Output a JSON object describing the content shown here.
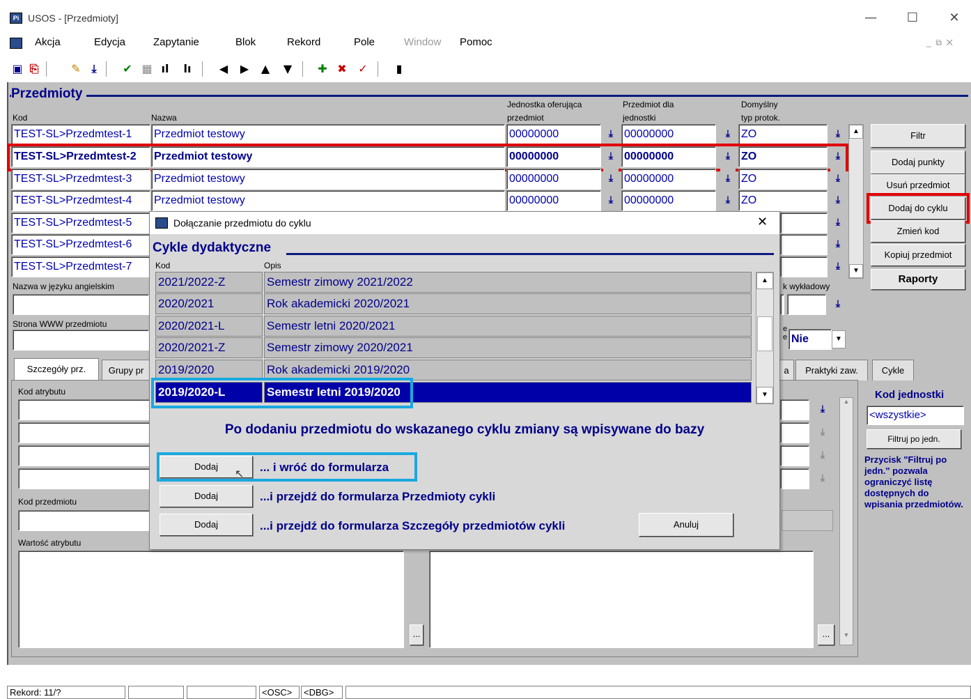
{
  "window": {
    "title": "USOS - [Przedmioty]",
    "app_icon": "Pi",
    "minimize": "—",
    "maximize": "☐",
    "close": "✕"
  },
  "menu": [
    {
      "label": "Akcja",
      "disabled": false
    },
    {
      "label": "Edycja",
      "disabled": false
    },
    {
      "label": "Zapytanie",
      "disabled": false
    },
    {
      "label": "Blok",
      "disabled": false
    },
    {
      "label": "Rekord",
      "disabled": false
    },
    {
      "label": "Pole",
      "disabled": false
    },
    {
      "label": "Window",
      "disabled": true
    },
    {
      "label": "Pomoc",
      "disabled": false
    }
  ],
  "form": {
    "section_title": "Przedmioty",
    "columns": {
      "kod": "Kod",
      "nazwa": "Nazwa",
      "jednostka_1": "Jednostka oferująca",
      "jednostka_2": "przedmiot",
      "przedmiot_dla_1": "Przedmiot dla",
      "przedmiot_dla_2": "jednostki",
      "typ_1": "Domyślny",
      "typ_2": "typ protok."
    },
    "rows": [
      {
        "kod": "TEST-SL>Przedmtest-1",
        "nazwa": "Przedmiot testowy",
        "jedn": "00000000",
        "dla": "00000000",
        "typ": "ZO"
      },
      {
        "kod": "TEST-SL>Przedmtest-2",
        "nazwa": "Przedmiot testowy",
        "jedn": "00000000",
        "dla": "00000000",
        "typ": "ZO"
      },
      {
        "kod": "TEST-SL>Przedmtest-3",
        "nazwa": "Przedmiot testowy",
        "jedn": "00000000",
        "dla": "00000000",
        "typ": "ZO"
      },
      {
        "kod": "TEST-SL>Przedmtest-4",
        "nazwa": "Przedmiot testowy",
        "jedn": "00000000",
        "dla": "00000000",
        "typ": "ZO"
      },
      {
        "kod": "TEST-SL>Przedmtest-5"
      },
      {
        "kod": "TEST-SL>Przedmtest-6"
      },
      {
        "kod": "TEST-SL>Przedmtest-7"
      }
    ],
    "buttons": {
      "filtr": "Filtr",
      "dodaj_punkty": "Dodaj punkty",
      "usun": "Usuń przedmiot",
      "dodaj_do_cyklu": "Dodaj do cyklu",
      "zmien_kod": "Zmień kod",
      "kopiuj": "Kopiuj przedmiot",
      "raporty": "Raporty"
    },
    "nazwa_ang_label": "Nazwa w języku angielskim",
    "www_label": "Strona WWW  przedmiotu",
    "jezyk_wykladowy_label": "k wykładowy",
    "nie_value": "Nie",
    "e_label_1": "e",
    "e_label_2": "e",
    "tabs": [
      "Szczegóły prz.",
      "Grupy pr",
      "a",
      "Praktyki zaw.",
      "Cykle"
    ],
    "kod_atrybutu_label": "Kod atrybutu",
    "kod_przedmiotu_label": "Kod przedmiotu",
    "wartosc_atrybutu_label": "Wartość atrybutu",
    "ellipsis": "...",
    "kod_jednostki_label": "Kod jednostki",
    "wszystkie": "<wszystkie>",
    "filtruj_btn": "Filtruj po jedn.",
    "filtruj_info": "Przycisk \"Filtruj po jedn.\" pozwala ograniczyć listę dostępnych do wpisania przedmiotów."
  },
  "dialog": {
    "title": "Dołączanie przedmiotu do cyklu",
    "close": "✕",
    "section_title": "Cykle dydaktyczne",
    "col_kod": "Kod",
    "col_opis": "Opis",
    "rows": [
      {
        "kod": "2021/2022-Z",
        "opis": "Semestr zimowy 2021/2022"
      },
      {
        "kod": "2020/2021",
        "opis": "Rok akademicki 2020/2021"
      },
      {
        "kod": "2020/2021-L",
        "opis": "Semestr letni 2020/2021"
      },
      {
        "kod": "2020/2021-Z",
        "opis": "Semestr zimowy 2020/2021"
      },
      {
        "kod": "2019/2020",
        "opis": "Rok akademicki 2019/2020"
      },
      {
        "kod": "2019/2020-L",
        "opis": "Semestr letni 2019/2020"
      }
    ],
    "info": "Po dodaniu przedmiotu do wskazanego cyklu zmiany są wpisywane do bazy",
    "actions": [
      {
        "button": "Dodaj",
        "label": "... i wróć do formularza"
      },
      {
        "button": "Dodaj",
        "label": "...i przejdź do formularza Przedmioty cykli"
      },
      {
        "button": "Dodaj",
        "label": "...i przejdź do formularza Szczegóły przedmiotów cykli"
      }
    ],
    "cancel": "Anuluj"
  },
  "status": {
    "rekord": "Rekord: 11/?",
    "osc": "<OSC>",
    "dbg": "<DBG>"
  },
  "colors": {
    "accent_red": "#e00000",
    "accent_blue": "#1aa8e0",
    "selection": "#0000a8",
    "form_bg": "#c0c0c0"
  }
}
